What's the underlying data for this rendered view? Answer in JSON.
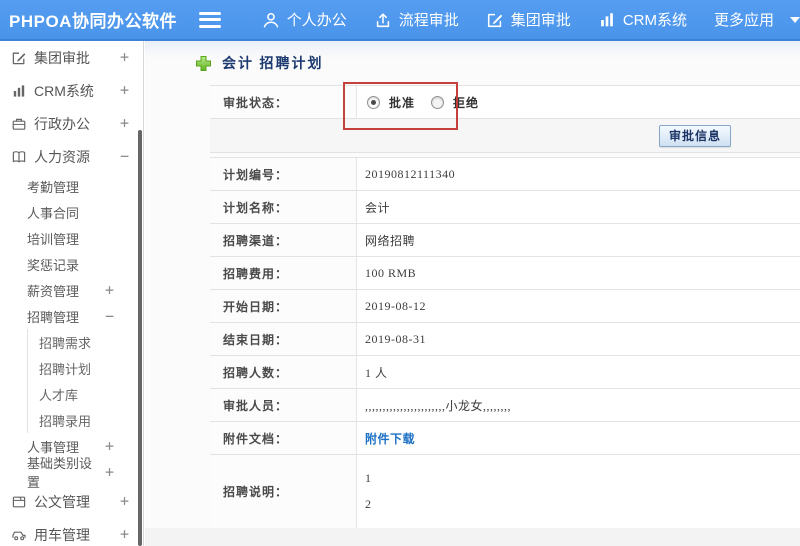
{
  "colors": {
    "header_blue": "#4a94ea",
    "header_blue_light": "#549df1",
    "header_blue_dark": "#3c82d8",
    "annotation_red": "#c5403d",
    "link_blue": "#1e71c5",
    "title_navy": "#1c3a70"
  },
  "header": {
    "logo": "PHPOA协同办公软件",
    "nav": [
      {
        "id": "personal-office",
        "label": "个人办公",
        "icon": "user-icon"
      },
      {
        "id": "process-approval",
        "label": "流程审批",
        "icon": "process-icon"
      },
      {
        "id": "group-approval",
        "label": "集团审批",
        "icon": "edit-square-icon"
      },
      {
        "id": "crm-system",
        "label": "CRM系统",
        "icon": "bar-chart-icon"
      },
      {
        "id": "more-apps",
        "label": "更多应用",
        "icon": "caret-down-icon"
      }
    ]
  },
  "sidebar": {
    "items": [
      {
        "id": "group-approval",
        "label": "集团审批",
        "level": 1,
        "icon": "edit-square-icon",
        "toggle": "+"
      },
      {
        "id": "crm-system",
        "label": "CRM系统",
        "level": 1,
        "icon": "bar-chart-icon",
        "toggle": "+"
      },
      {
        "id": "admin-office",
        "label": "行政办公",
        "level": 1,
        "icon": "briefcase-icon",
        "toggle": "+"
      },
      {
        "id": "human-resources",
        "label": "人力资源",
        "level": 1,
        "icon": "book-icon",
        "toggle": "−"
      },
      {
        "id": "attendance-mgmt",
        "label": "考勤管理",
        "level": 2,
        "toggle": ""
      },
      {
        "id": "hr-contract",
        "label": "人事合同",
        "level": 2,
        "toggle": ""
      },
      {
        "id": "training-mgmt",
        "label": "培训管理",
        "level": 2,
        "toggle": ""
      },
      {
        "id": "reward-punishment-records",
        "label": "奖惩记录",
        "level": 2,
        "toggle": ""
      },
      {
        "id": "salary-mgmt",
        "label": "薪资管理",
        "level": 2,
        "toggle": "+"
      },
      {
        "id": "recruit-mgmt",
        "label": "招聘管理",
        "level": 2,
        "toggle": "−"
      },
      {
        "id": "recruit-demand",
        "label": "招聘需求",
        "level": 3,
        "toggle": ""
      },
      {
        "id": "recruit-plan",
        "label": "招聘计划",
        "level": 3,
        "toggle": ""
      },
      {
        "id": "talent-pool",
        "label": "人才库",
        "level": 3,
        "toggle": ""
      },
      {
        "id": "recruit-hire",
        "label": "招聘录用",
        "level": 3,
        "toggle": ""
      },
      {
        "id": "personnel-mgmt",
        "label": "人事管理",
        "level": 2,
        "toggle": "+"
      },
      {
        "id": "base-category-settings",
        "label": "基础类别设置",
        "level": 2,
        "toggle": "+"
      },
      {
        "id": "document-mgmt",
        "label": "公文管理",
        "level": 1,
        "icon": "doc-icon",
        "toggle": "+"
      },
      {
        "id": "vehicle-mgmt",
        "label": "用车管理",
        "level": 1,
        "icon": "car-icon",
        "toggle": "+"
      }
    ]
  },
  "main": {
    "title": "会计 招聘计划",
    "status_row": {
      "label": "审批状态：",
      "options": [
        {
          "label": "批准",
          "selected": true
        },
        {
          "label": "拒绝",
          "selected": false
        }
      ]
    },
    "button_bar": {
      "approve_info_label": "审批信息"
    },
    "fields": [
      {
        "id": "plan-number",
        "label": "计划编号：",
        "value": "20190812111340",
        "type": "text"
      },
      {
        "id": "plan-name",
        "label": "计划名称：",
        "value": "会计",
        "type": "text"
      },
      {
        "id": "recruit-channel",
        "label": "招聘渠道：",
        "value": "网络招聘",
        "type": "text"
      },
      {
        "id": "recruit-cost",
        "label": "招聘费用：",
        "value": "100 RMB",
        "type": "text"
      },
      {
        "id": "start-date",
        "label": "开始日期：",
        "value": "2019-08-12",
        "type": "text"
      },
      {
        "id": "end-date",
        "label": "结束日期：",
        "value": "2019-08-31",
        "type": "text"
      },
      {
        "id": "recruit-headcount",
        "label": "招聘人数：",
        "value": "1 人",
        "type": "text"
      },
      {
        "id": "approvers",
        "label": "审批人员：",
        "value": ",,,,,,,,,,,,,,,,,,,,,,,小龙女,,,,,,,,",
        "type": "text"
      },
      {
        "id": "attachment-doc",
        "label": "附件文档：",
        "value": "附件下载",
        "type": "link"
      },
      {
        "id": "recruit-description",
        "label": "招聘说明：",
        "lines": [
          "1",
          "2"
        ],
        "type": "multiline"
      }
    ]
  }
}
